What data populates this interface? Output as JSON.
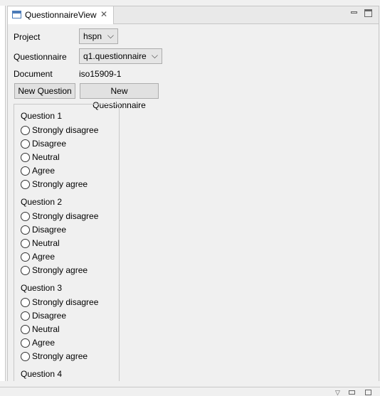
{
  "tab": {
    "title": "QuestionnaireView",
    "close_glyph": "✕"
  },
  "form": {
    "project_label": "Project",
    "project_value": "hspn",
    "questionnaire_label": "Questionnaire",
    "questionnaire_value": "q1.questionnaire",
    "document_label": "Document",
    "document_value": "iso15909-1"
  },
  "buttons": {
    "new_question": "New Question",
    "new_questionnaire": "New Questionnaire"
  },
  "questions": [
    {
      "title": "Question 1",
      "options": [
        "Strongly disagree",
        "Disagree",
        "Neutral",
        "Agree",
        "Strongly agree"
      ]
    },
    {
      "title": "Question 2",
      "options": [
        "Strongly disagree",
        "Disagree",
        "Neutral",
        "Agree",
        "Strongly agree"
      ]
    },
    {
      "title": "Question 3",
      "options": [
        "Strongly disagree",
        "Disagree",
        "Neutral",
        "Agree",
        "Strongly agree"
      ]
    },
    {
      "title": "Question 4",
      "options": []
    }
  ]
}
